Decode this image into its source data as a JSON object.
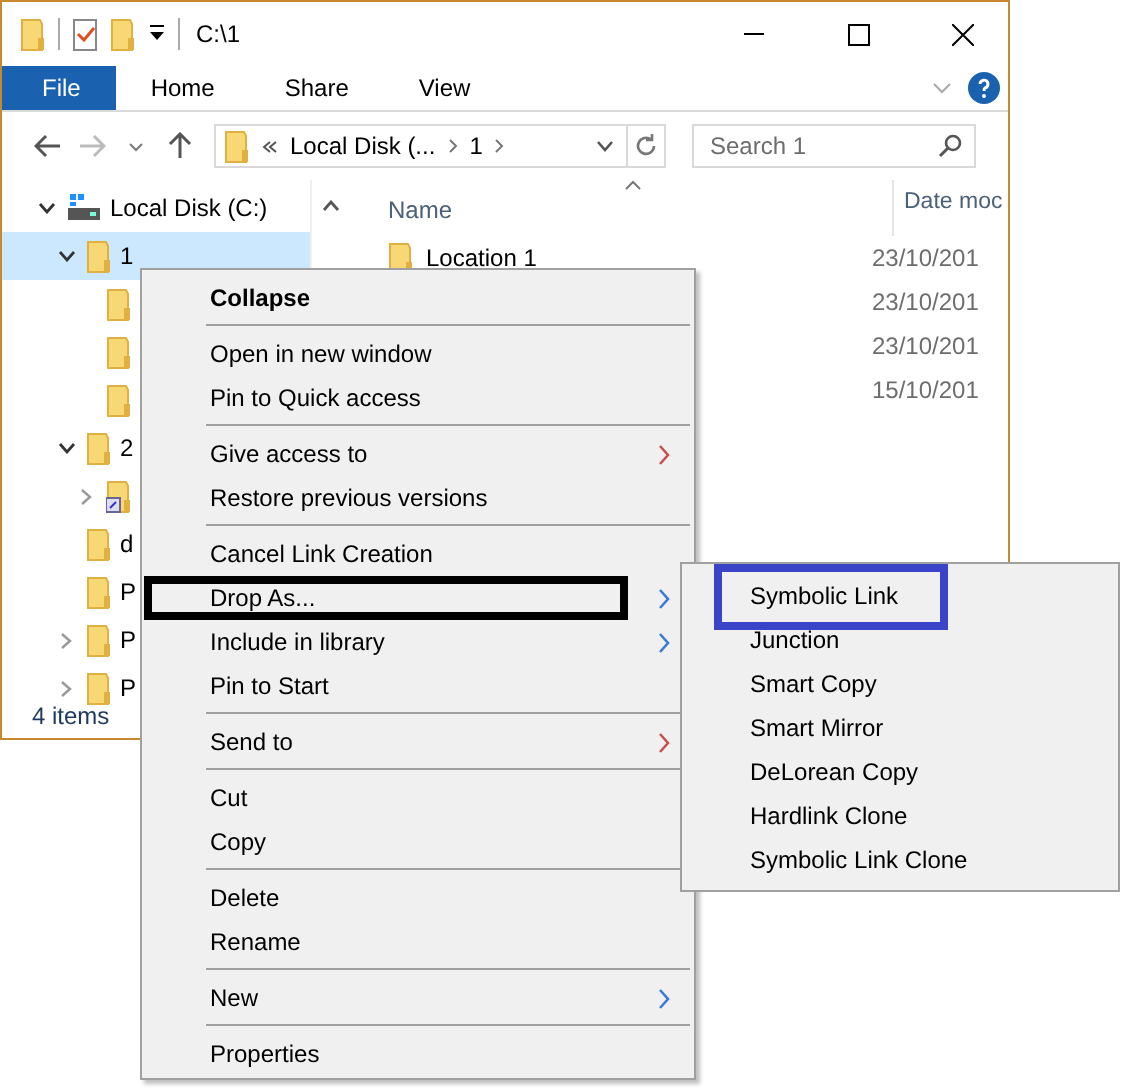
{
  "window": {
    "title": "C:\\1"
  },
  "ribbon": {
    "tabs": [
      {
        "label": "File",
        "selected": true
      },
      {
        "label": "Home",
        "selected": false
      },
      {
        "label": "Share",
        "selected": false
      },
      {
        "label": "View",
        "selected": false
      }
    ]
  },
  "address": {
    "crumbs": [
      "Local Disk (...",
      "1"
    ],
    "search_placeholder": "Search 1"
  },
  "tree": [
    {
      "label": "Local Disk (C:)",
      "kind": "drive",
      "expanded": true,
      "selected": false,
      "children": [
        {
          "label": "1",
          "kind": "folder",
          "expanded": true,
          "selected": true,
          "children": [
            {
              "kind": "folder",
              "selected": false
            },
            {
              "kind": "folder",
              "selected": false
            },
            {
              "kind": "folder",
              "selected": false
            }
          ]
        },
        {
          "label": "2",
          "kind": "folder",
          "expanded": true,
          "selected": false,
          "children": [
            {
              "kind": "link-folder",
              "expanded": false,
              "selected": false
            }
          ]
        },
        {
          "label": "d",
          "kind": "folder",
          "selected": false
        },
        {
          "label": "P",
          "kind": "folder",
          "selected": false
        },
        {
          "label": "P",
          "kind": "folder",
          "expanded": false,
          "selected": false
        },
        {
          "label": "P",
          "kind": "folder",
          "expanded": false,
          "selected": false
        }
      ]
    }
  ],
  "files": {
    "columns": [
      "Name",
      "Date moc"
    ],
    "rows": [
      {
        "name": "Location 1",
        "date": "23/10/201"
      },
      {
        "date": "23/10/201"
      },
      {
        "date": "23/10/201"
      },
      {
        "date": "15/10/201"
      }
    ]
  },
  "status_bar": "4 items",
  "context_menu": {
    "groups": [
      [
        {
          "label": "Collapse",
          "bold": true
        }
      ],
      [
        {
          "label": "Open in new window"
        },
        {
          "label": "Pin to Quick access"
        }
      ],
      [
        {
          "label": "Give access to",
          "color": "#c8504c"
        },
        {
          "label": "Restore previous versions"
        }
      ],
      [
        {
          "label": "Cancel Link Creation"
        },
        {
          "label": "Drop As...",
          "color": "#3a7bd5",
          "highlighted": true
        },
        {
          "label": "Include in library",
          "color": "#3a7bd5"
        },
        {
          "label": "Pin to Start"
        }
      ],
      [
        {
          "label": "Send to",
          "color": "#c8504c"
        }
      ],
      [
        {
          "label": "Cut"
        },
        {
          "label": "Copy"
        }
      ],
      [
        {
          "label": "Delete"
        },
        {
          "label": "Rename"
        }
      ],
      [
        {
          "label": "New",
          "color": "#3a7bd5"
        }
      ],
      [
        {
          "label": "Properties"
        }
      ]
    ]
  },
  "submenu": {
    "items": [
      {
        "label": "Symbolic Link",
        "highlighted": true
      },
      {
        "label": "Junction",
        "highlighted": false
      },
      {
        "label": "Smart Copy",
        "highlighted": false
      },
      {
        "label": "Smart Mirror",
        "highlighted": false
      },
      {
        "label": "DeLorean Copy",
        "highlighted": false
      },
      {
        "label": "Hardlink Clone",
        "highlighted": false
      },
      {
        "label": "Symbolic Link Clone",
        "highlighted": false
      }
    ]
  }
}
